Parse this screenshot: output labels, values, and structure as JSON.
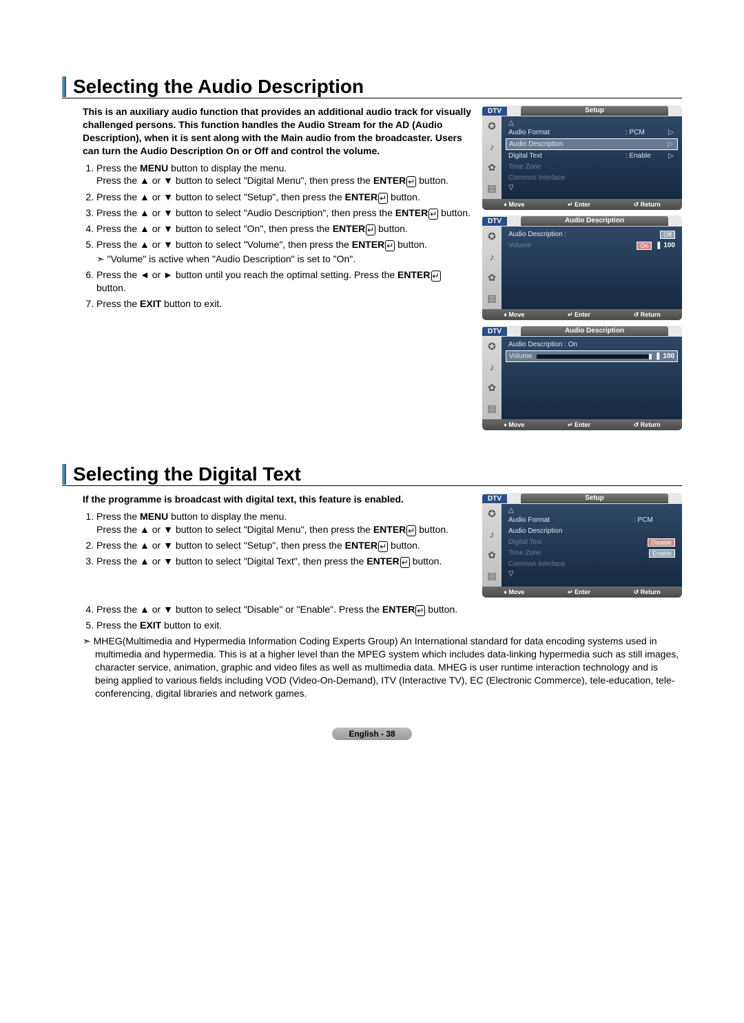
{
  "section1": {
    "title": "Selecting the Audio Description",
    "intro": "This is an auxiliary audio function that provides an additional audio track for visually challenged persons. This function handles the Audio Stream for the AD (Audio Description), when it is sent along with the Main audio from the broadcaster. Users can turn the Audio Description On or Off and control the volume.",
    "steps": [
      "Press the MENU button to display the menu. Press the ▲ or ▼ button to select \"Digital Menu\", then press the ENTER button.",
      "Press the ▲ or ▼ button to select \"Setup\", then press the ENTER button.",
      "Press the ▲ or ▼ button to select \"Audio Description\", then press the ENTER button.",
      "Press the ▲ or ▼ button to select \"On\", then press the ENTER button.",
      "Press the ▲ or ▼ button to select \"Volume\", then press the ENTER button.",
      "Press the ◄ or ► button until you reach the optimal setting. Press the ENTER button.",
      "Press the EXIT button to exit."
    ],
    "note5": "\"Volume\" is active when \"Audio Description\" is set to \"On\".",
    "osd1": {
      "dtv": "DTV",
      "tab": "Setup",
      "rows": {
        "audio_format": "Audio Format",
        "audio_format_val": ": PCM",
        "audio_desc": "Audio Description",
        "digital_text": "Digital Text",
        "digital_text_val": ": Enable",
        "time_zone": "Time Zone",
        "common_if": "Common Interface"
      },
      "footer": {
        "move": "Move",
        "enter": "Enter",
        "return": "Return"
      }
    },
    "osd2": {
      "dtv": "DTV",
      "tab": "Audio Description",
      "rows": {
        "audio_desc": "Audio Description :",
        "dropdown_off": "Off",
        "dropdown_on": "On",
        "volume": "Volume",
        "vol_val": "100"
      },
      "footer": {
        "move": "Move",
        "enter": "Enter",
        "return": "Return"
      }
    },
    "osd3": {
      "dtv": "DTV",
      "tab": "Audio Description",
      "rows": {
        "audio_desc": "Audio Description : On",
        "volume": "Volume",
        "vol_val": "100"
      },
      "footer": {
        "move": "Move",
        "enter": "Enter",
        "return": "Return"
      }
    }
  },
  "section2": {
    "title": "Selecting the Digital Text",
    "intro": "If the programme is broadcast with digital text, this feature is enabled.",
    "steps": [
      "Press the MENU button to display the menu. Press the ▲ or ▼ button to select \"Digital Menu\", then press the ENTER button.",
      "Press the ▲ or ▼ button to select \"Setup\", then press the ENTER button.",
      "Press the ▲ or ▼ button to select \"Digital Text\", then press the ENTER button.",
      "Press the ▲ or ▼ button to select \"Disable\" or \"Enable\". Press the ENTER button.",
      "Press the EXIT button to exit."
    ],
    "mheg_note": "MHEG(Multimedia and Hypermedia Information Coding Experts Group) An International standard for data encoding systems used in multimedia and hypermedia. This is at a higher level than the MPEG system which includes data-linking hypermedia such as still images, character service, animation, graphic and video files as well as multimedia data. MHEG is user runtime interaction technology and is being applied to various fields including VOD (Video-On-Demand), ITV (Interactive TV), EC (Electronic Commerce), tele-education, tele-conferencing, digital libraries and network games.",
    "osd": {
      "dtv": "DTV",
      "tab": "Setup",
      "rows": {
        "audio_format": "Audio Format",
        "audio_format_val": ": PCM",
        "audio_desc": "Audio Description",
        "digital_text": "Digital Text",
        "opt_disable": "Disable",
        "opt_enable": "Enable",
        "time_zone": "Time Zone",
        "common_if": "Common Interface"
      },
      "footer": {
        "move": "Move",
        "enter": "Enter",
        "return": "Return"
      }
    }
  },
  "page_footer": "English - 38"
}
